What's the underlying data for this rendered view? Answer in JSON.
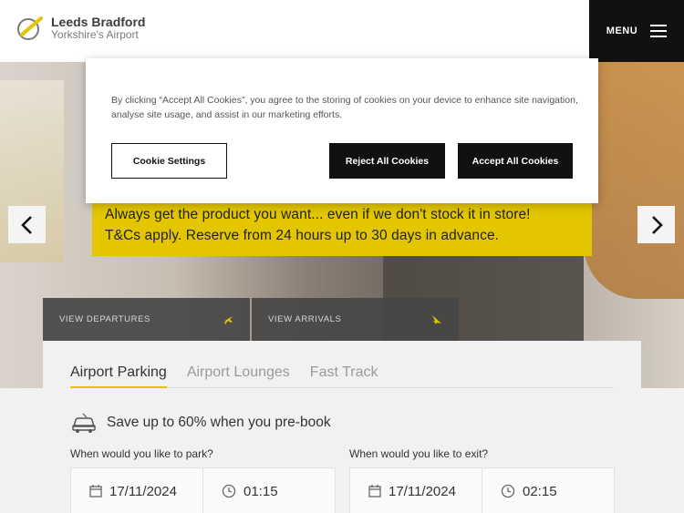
{
  "header": {
    "logo_title": "Leeds Bradford",
    "logo_subtitle": "Yorkshire's Airport",
    "menu_label": "MENU"
  },
  "hero": {
    "banner_line1": "Always get the product you want... even if we don't stock it in store!",
    "banner_line2": "T&Cs apply. Reserve from 24 hours up to 30 days in advance."
  },
  "flights": {
    "departures_label": "VIEW DEPARTURES",
    "arrivals_label": "VIEW ARRIVALS"
  },
  "booking": {
    "tabs": [
      {
        "label": "Airport Parking",
        "active": true
      },
      {
        "label": "Airport Lounges",
        "active": false
      },
      {
        "label": "Fast Track",
        "active": false
      }
    ],
    "promo": "Save up to 60% when you pre-book",
    "park_question": "When would you like to park?",
    "exit_question": "When would you like to exit?",
    "park_date": "17/11/2024",
    "park_time": "01:15",
    "exit_date": "17/11/2024",
    "exit_time": "02:15"
  },
  "cookie": {
    "text": "By clicking “Accept All Cookies”, you agree to the storing of cookies on your device to enhance site navigation, analyse site usage, and assist in our marketing efforts.",
    "settings_label": "Cookie Settings",
    "reject_label": "Reject All Cookies",
    "accept_label": "Accept All Cookies"
  },
  "colors": {
    "accent": "#e3c600",
    "dark": "#111111"
  }
}
